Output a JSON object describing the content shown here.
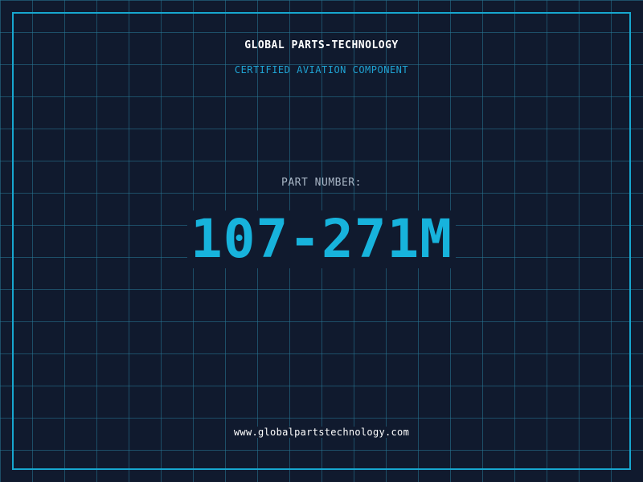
{
  "header": {
    "company": "GLOBAL PARTS-TECHNOLOGY",
    "subtitle": "CERTIFIED AVIATION COMPONENT"
  },
  "part": {
    "label": "PART NUMBER:",
    "number": "107-271M"
  },
  "footer": {
    "url": "www.globalpartstechnology.com"
  },
  "colors": {
    "background": "#101a2e",
    "grid": "#287896",
    "accent": "#17b3dc",
    "frame": "#17a7cf"
  }
}
